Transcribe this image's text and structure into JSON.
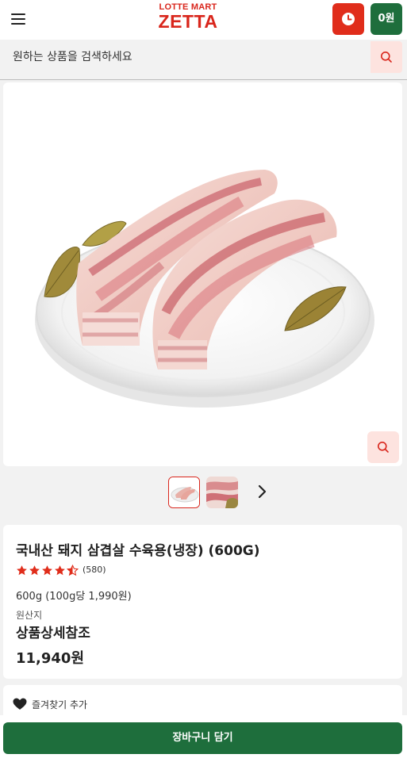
{
  "header": {
    "logo_top": "LOTTE MART",
    "logo_main": "ZETTA",
    "cart_amount": "0원",
    "menu_icon": "hamburger-menu-icon",
    "history_icon": "clock-icon"
  },
  "search": {
    "placeholder": "원하는 상품을 검색하세요",
    "icon": "search-icon"
  },
  "product": {
    "title": "국내산 돼지 삼겹살 수육용(냉장) (600G)",
    "rating": 4.5,
    "rating_count": "(580)",
    "unit_price": "600g (100g당 1,990원)",
    "origin_label": "원산지",
    "origin_value": "상품상세참조",
    "price": "11,940원"
  },
  "gallery": {
    "thumbnail_count": 2,
    "active_thumbnail": 1,
    "next_icon": "chevron-right-icon",
    "zoom_icon": "search-icon"
  },
  "favorite": {
    "label": "즐겨찾기 추가",
    "icon": "heart-icon"
  },
  "actions": {
    "add_to_cart": "장바구니 담기"
  },
  "colors": {
    "brand_red": "#d9261c",
    "clock_red": "#e02d1b",
    "brand_green": "#1e6e3c",
    "accent_pink": "#fde3df"
  }
}
